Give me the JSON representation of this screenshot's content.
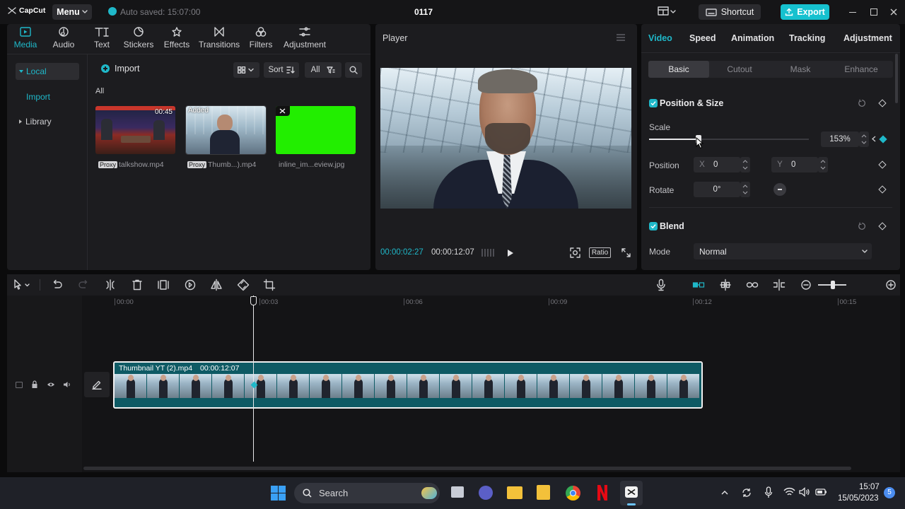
{
  "app": {
    "logo": "CapCut",
    "menu": "Menu",
    "autosave": "Auto saved: 15:07:00",
    "title": "0117",
    "shortcut": "Shortcut",
    "export": "Export"
  },
  "media_tabs": [
    {
      "label": "Media"
    },
    {
      "label": "Audio"
    },
    {
      "label": "Text"
    },
    {
      "label": "Stickers"
    },
    {
      "label": "Effects"
    },
    {
      "label": "Transitions"
    },
    {
      "label": "Filters"
    },
    {
      "label": "Adjustment"
    }
  ],
  "media_sidebar": {
    "local": "Local",
    "import": "Import",
    "library": "Library"
  },
  "media_toolbar": {
    "import": "Import",
    "sort": "Sort",
    "all": "All"
  },
  "media_filter_label": "All",
  "media_items": [
    {
      "name": "talkshow.mp4",
      "badge": "Proxy",
      "duration": "00:45"
    },
    {
      "name": "Thumb...).mp4",
      "badge": "Proxy",
      "tag": "Added"
    },
    {
      "name": "inline_im...eview.jpg"
    }
  ],
  "player": {
    "title": "Player",
    "current_time": "00:00:02:27",
    "total_time": "00:00:12:07",
    "ratio": "Ratio"
  },
  "inspector": {
    "tabs": [
      "Video",
      "Speed",
      "Animation",
      "Tracking",
      "Adjustment"
    ],
    "subtabs": [
      "Basic",
      "Cutout",
      "Mask",
      "Enhance"
    ],
    "position_size": "Position & Size",
    "scale_label": "Scale",
    "scale_value": "153%",
    "scale_fraction": 0.31,
    "position_label": "Position",
    "x_label": "X",
    "x_value": "0",
    "y_label": "Y",
    "y_value": "0",
    "rotate_label": "Rotate",
    "rotate_value": "0°",
    "blend": "Blend",
    "mode_label": "Mode",
    "mode_value": "Normal"
  },
  "timeline": {
    "ticks": [
      "00:00",
      "00:03",
      "00:06",
      "00:09",
      "00:12",
      "00:15"
    ],
    "clip_name": "Thumbnail YT (2).mp4",
    "clip_duration": "00:00:12:07"
  },
  "taskbar": {
    "search": "Search",
    "time": "15:07",
    "date": "15/05/2023",
    "badge": "5"
  },
  "colors": {
    "accent": "#1fb8c9",
    "export": "#16c1cf",
    "green": "#22ee00"
  }
}
